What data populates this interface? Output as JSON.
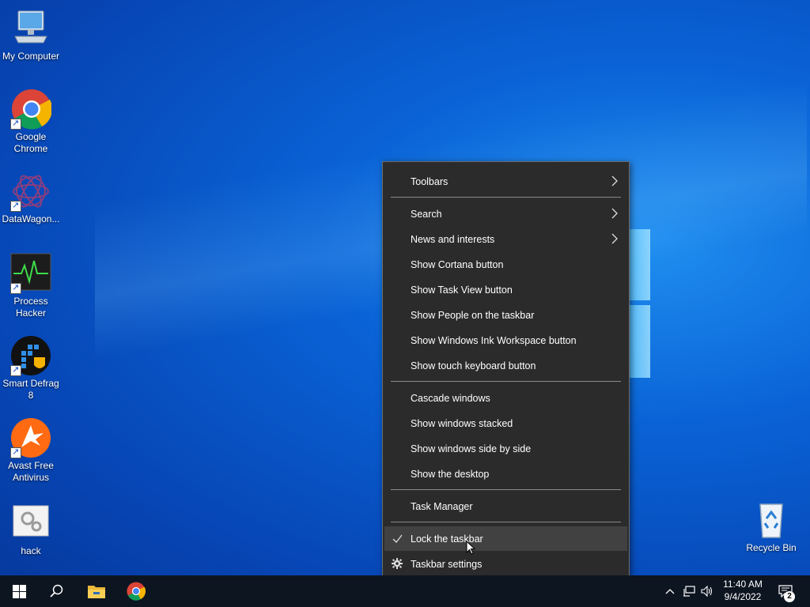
{
  "desktop": {
    "icons": [
      {
        "label": "My Computer",
        "icon": "computer-icon"
      },
      {
        "label": "Google Chrome",
        "icon": "chrome-icon"
      },
      {
        "label": "DataWagon...",
        "icon": "datawagon-icon"
      },
      {
        "label": "Process Hacker",
        "icon": "process-hacker-icon"
      },
      {
        "label": "Smart Defrag 8",
        "icon": "smart-defrag-icon"
      },
      {
        "label": "Avast Free Antivirus",
        "icon": "avast-icon"
      },
      {
        "label": "hack",
        "icon": "hack-icon"
      },
      {
        "label": "Recycle Bin",
        "icon": "recycle-bin-icon"
      }
    ]
  },
  "context_menu": {
    "items": [
      {
        "label": "Toolbars",
        "submenu": true
      },
      {
        "label": "Search",
        "submenu": true
      },
      {
        "label": "News and interests",
        "submenu": true
      },
      {
        "label": "Show Cortana button"
      },
      {
        "label": "Show Task View button"
      },
      {
        "label": "Show People on the taskbar"
      },
      {
        "label": "Show Windows Ink Workspace button"
      },
      {
        "label": "Show touch keyboard button"
      },
      {
        "label": "Cascade windows"
      },
      {
        "label": "Show windows stacked"
      },
      {
        "label": "Show windows side by side"
      },
      {
        "label": "Show the desktop"
      },
      {
        "label": "Task Manager"
      },
      {
        "label": "Lock the taskbar",
        "checked": true,
        "highlighted": true
      },
      {
        "label": "Taskbar settings",
        "icon": "gear-icon"
      }
    ]
  },
  "taskbar": {
    "pinned": [
      "windows-start-icon",
      "search-icon",
      "file-explorer-icon",
      "chrome-icon"
    ],
    "tray_icons": [
      "chevron-up-icon",
      "network-icon",
      "volume-icon"
    ],
    "clock": {
      "time": "11:40 AM",
      "date": "9/4/2022"
    },
    "notifications": {
      "count": "2"
    }
  },
  "colors": {
    "menu_bg": "#2b2b2b",
    "menu_highlight": "#414141",
    "taskbar_bg": "#0d1520",
    "desktop_blue": "#0a63d6"
  }
}
